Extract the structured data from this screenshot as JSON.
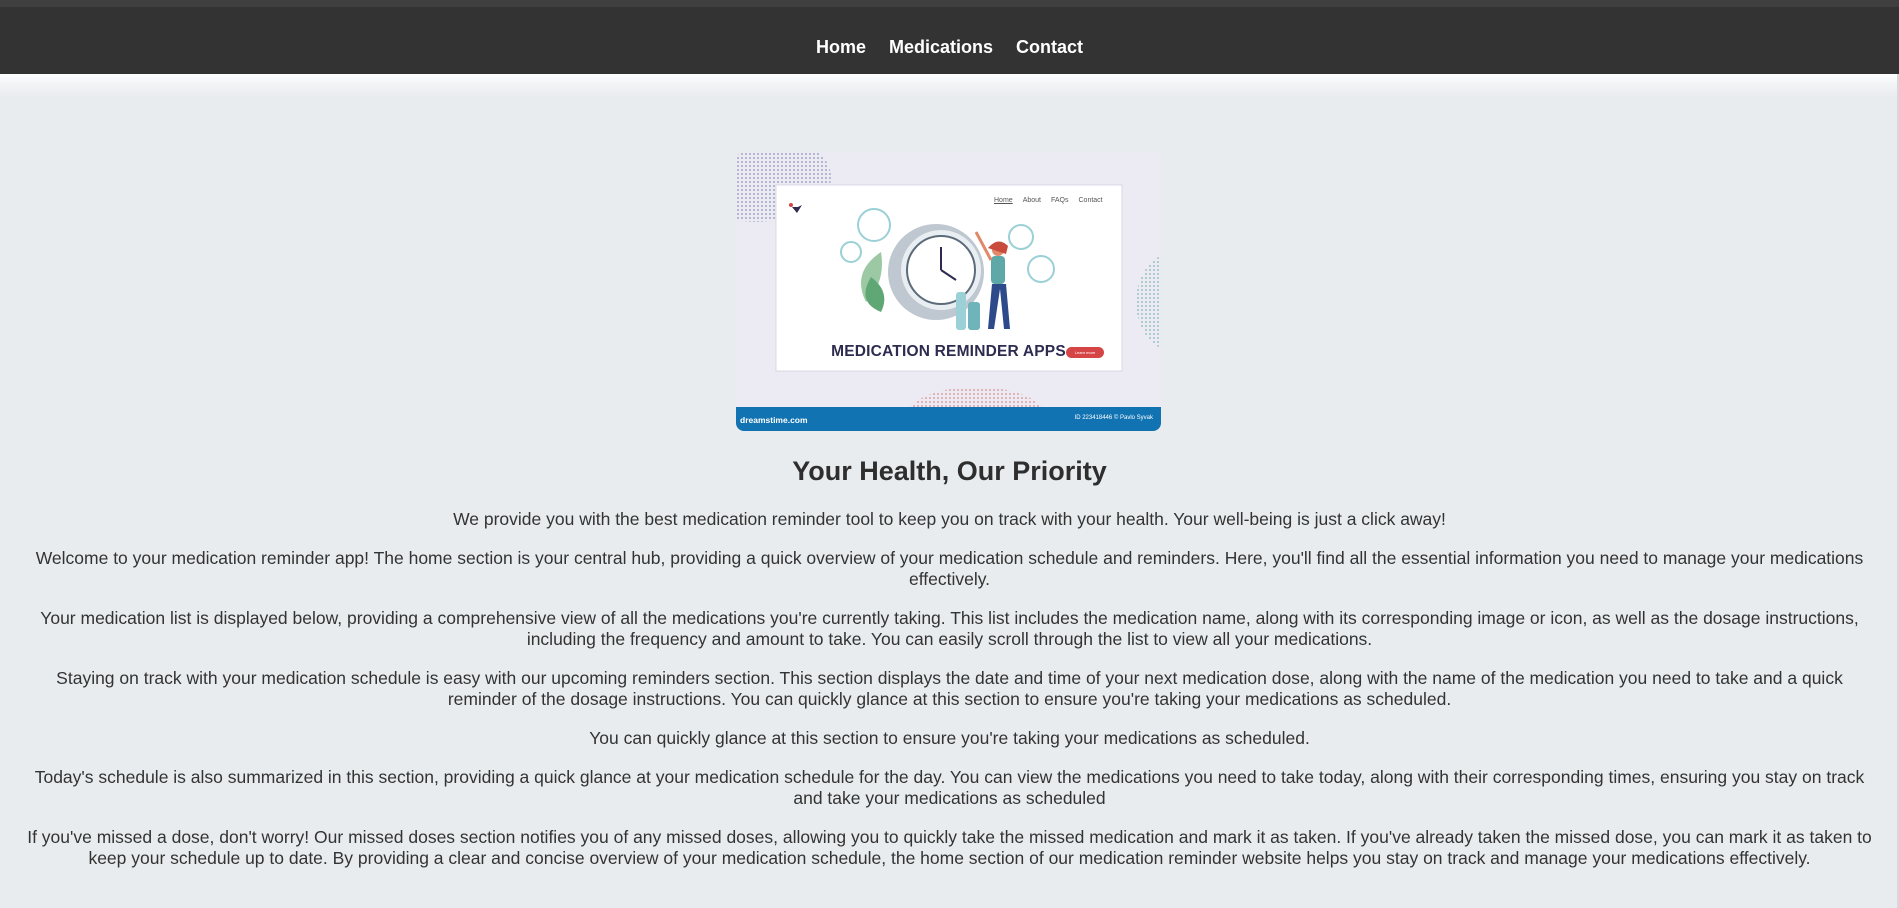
{
  "nav": {
    "items": [
      {
        "label": "Home"
      },
      {
        "label": "Medications"
      },
      {
        "label": "Contact"
      }
    ]
  },
  "hero": {
    "image_title": "MEDICATION REMINDER APPS",
    "mini_nav": [
      "Home",
      "About",
      "FAQs",
      "Contact"
    ],
    "button": "Learn more",
    "watermark_left": "dreamstime.com",
    "watermark_right": "ID 223418446 © Pavlo Syvak"
  },
  "main": {
    "heading": "Your Health, Our Priority",
    "paragraphs": [
      "We provide you with the best medication reminder tool to keep you on track with your health. Your well-being is just a click away!",
      "Welcome to your medication reminder app! The home section is your central hub, providing a quick overview of your medication schedule and reminders. Here, you'll find all the essential information you need to manage your medications effectively.",
      "Your medication list is displayed below, providing a comprehensive view of all the medications you're currently taking. This list includes the medication name, along with its corresponding image or icon, as well as the dosage instructions, including the frequency and amount to take. You can easily scroll through the list to view all your medications.",
      "Staying on track with your medication schedule is easy with our upcoming reminders section. This section displays the date and time of your next medication dose, along with the name of the medication you need to take and a quick reminder of the dosage instructions. You can quickly glance at this section to ensure you're taking your medications as scheduled.",
      "You can quickly glance at this section to ensure you're taking your medications as scheduled.",
      "Today's schedule is also summarized in this section, providing a quick glance at your medication schedule for the day. You can view the medications you need to take today, along with their corresponding times, ensuring you stay on track and take your medications as scheduled",
      "If you've missed a dose, don't worry! Our missed doses section notifies you of any missed doses, allowing you to quickly take the missed medication and mark it as taken. If you've already taken the missed dose, you can mark it as taken to keep your schedule up to date. By providing a clear and concise overview of your medication schedule, the home section of our medication reminder website helps you stay on track and manage your medications effectively."
    ]
  },
  "colors": {
    "navbar": "#333333",
    "background": "#e9ecef",
    "text": "#333333",
    "image_footer": "#1173b1"
  }
}
